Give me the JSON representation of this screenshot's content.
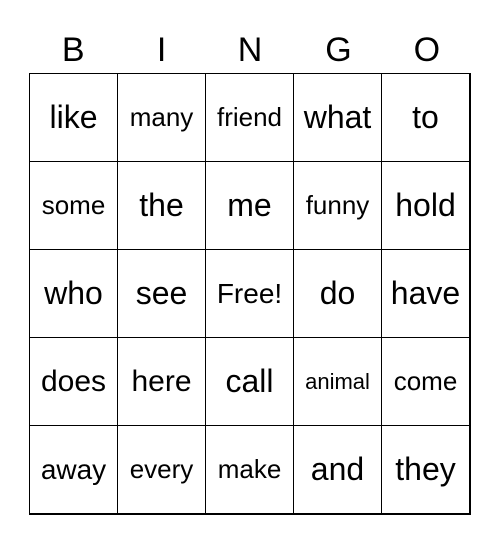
{
  "header": [
    "B",
    "I",
    "N",
    "G",
    "O"
  ],
  "cells": [
    [
      "like",
      "many",
      "friend",
      "what",
      "to"
    ],
    [
      "some",
      "the",
      "me",
      "funny",
      "hold"
    ],
    [
      "who",
      "see",
      "Free!",
      "do",
      "have"
    ],
    [
      "does",
      "here",
      "call",
      "animal",
      "come"
    ],
    [
      "away",
      "every",
      "make",
      "and",
      "they"
    ]
  ]
}
